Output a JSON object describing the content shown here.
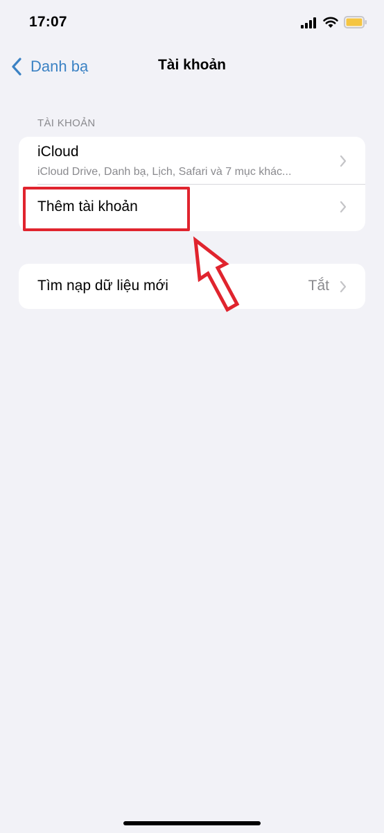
{
  "status_bar": {
    "time": "17:07",
    "icons": [
      "signal-icon",
      "wifi-icon",
      "battery-icon"
    ],
    "battery_color": "#f5c542"
  },
  "nav": {
    "back_label": "Danh bạ",
    "title": "Tài khoản"
  },
  "accounts_section": {
    "header": "TÀI KHOẢN",
    "rows": [
      {
        "title": "iCloud",
        "subtitle": "iCloud Drive, Danh bạ, Lịch, Safari và 7 mục khác..."
      },
      {
        "title": "Thêm tài khoản"
      }
    ]
  },
  "fetch_section": {
    "title": "Tìm nạp dữ liệu mới",
    "value": "Tắt"
  },
  "colors": {
    "accent": "#3b82c4",
    "annotation": "#e0242e",
    "background": "#f2f2f7"
  }
}
